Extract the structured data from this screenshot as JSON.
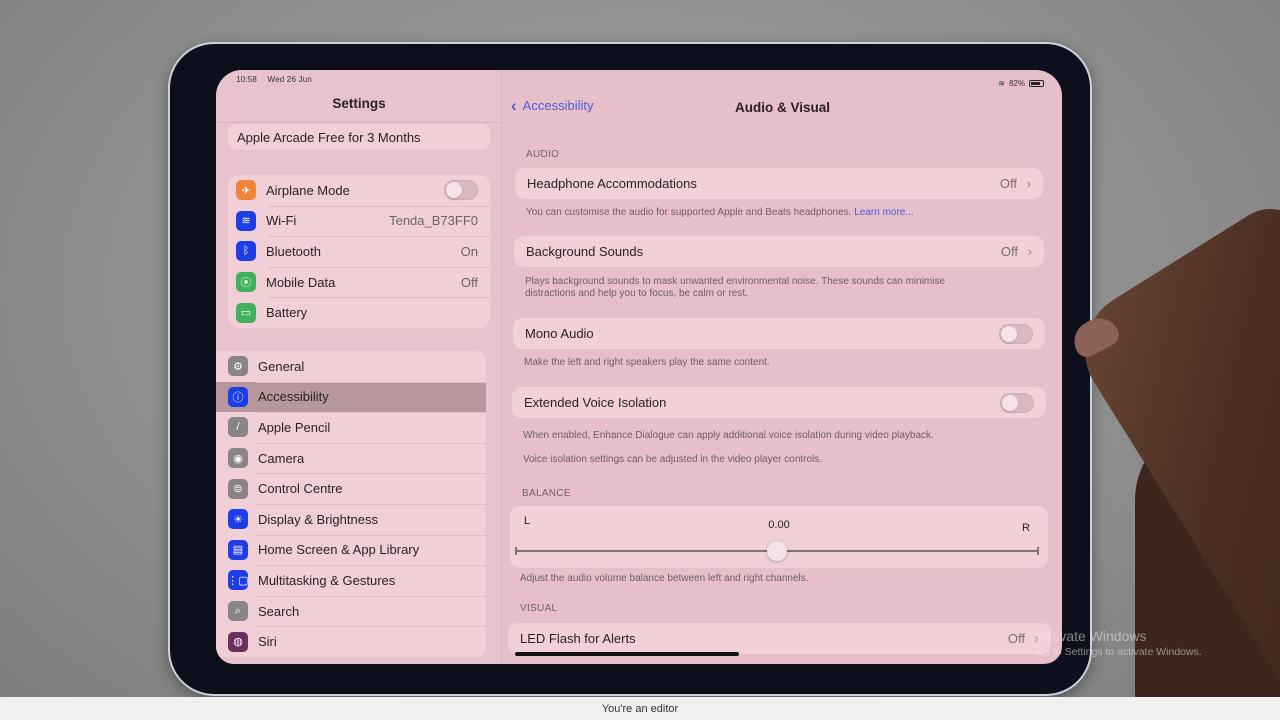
{
  "status_bar": {
    "time": "10:58",
    "date": "Wed 26 Jun",
    "battery_percent": "82%",
    "wifi_icon": "wifi-icon",
    "battery_icon": "battery-icon"
  },
  "sidebar": {
    "title": "Settings",
    "promo": "Apple Arcade Free for 3 Months",
    "connectivity": [
      {
        "label": "Airplane Mode",
        "icon": "airplane-icon",
        "color": "#f0853a",
        "glyph": "✈",
        "control": "toggle",
        "state": "off"
      },
      {
        "label": "Wi-Fi",
        "icon": "wifi-icon",
        "color": "#1f3de6",
        "glyph": "≋",
        "value": "Tenda_B73FF0"
      },
      {
        "label": "Bluetooth",
        "icon": "bluetooth-icon",
        "color": "#1f3de6",
        "glyph": "ᛒ",
        "value": "On"
      },
      {
        "label": "Mobile Data",
        "icon": "antenna-icon",
        "color": "#43b05c",
        "glyph": "⦿",
        "value": "Off"
      },
      {
        "label": "Battery",
        "icon": "battery-icon",
        "color": "#43b05c",
        "glyph": "▭"
      }
    ],
    "general": [
      {
        "label": "General",
        "icon": "gear-icon",
        "color": "#8a8488",
        "glyph": "⚙"
      },
      {
        "label": "Accessibility",
        "icon": "accessibility-icon",
        "color": "#1f3de6",
        "glyph": "ⓘ",
        "selected": true
      },
      {
        "label": "Apple Pencil",
        "icon": "pencil-icon",
        "color": "#8a8488",
        "glyph": "/"
      },
      {
        "label": "Camera",
        "icon": "camera-icon",
        "color": "#8a8488",
        "glyph": "◉"
      },
      {
        "label": "Control Centre",
        "icon": "switches-icon",
        "color": "#8a8488",
        "glyph": "⊜"
      },
      {
        "label": "Display & Brightness",
        "icon": "sun-icon",
        "color": "#1f3de6",
        "glyph": "☀"
      },
      {
        "label": "Home Screen & App Library",
        "icon": "home-screen-icon",
        "color": "#1f3de6",
        "glyph": "▤"
      },
      {
        "label": "Multitasking & Gestures",
        "icon": "multitasking-icon",
        "color": "#1f3de6",
        "glyph": "⋮▢"
      },
      {
        "label": "Search",
        "icon": "search-icon",
        "color": "#8a8488",
        "glyph": "⌕"
      },
      {
        "label": "Siri",
        "icon": "siri-icon",
        "color": "#6a2f5e",
        "glyph": "◍"
      }
    ]
  },
  "detail": {
    "back_label": "Accessibility",
    "title": "Audio & Visual",
    "sections": {
      "audio_header": "AUDIO",
      "balance_header": "BALANCE",
      "visual_header": "VISUAL"
    },
    "headphone": {
      "label": "Headphone Accommodations",
      "value": "Off",
      "footnote": "You can customise the audio for supported Apple and Beats headphones.",
      "link": "Learn more..."
    },
    "background_sounds": {
      "label": "Background Sounds",
      "value": "Off",
      "footnote": "Plays background sounds to mask unwanted environmental noise. These sounds can minimise distractions and help you to focus, be calm or rest."
    },
    "mono_audio": {
      "label": "Mono Audio",
      "state": "off",
      "footnote": "Make the left and right speakers play the same content."
    },
    "voice_isolation": {
      "label": "Extended Voice Isolation",
      "state": "off",
      "footnote1": "When enabled, Enhance Dialogue can apply additional voice isolation during video playback.",
      "footnote2": "Voice isolation settings can be adjusted in the video player controls."
    },
    "balance": {
      "left": "L",
      "right": "R",
      "value_label": "0.00",
      "value": 0.0,
      "min": -1,
      "max": 1,
      "footnote": "Adjust the audio volume balance between left and right channels."
    },
    "led_flash": {
      "label": "LED Flash for Alerts",
      "value": "Off"
    }
  },
  "watermark": {
    "title": "Activate Windows",
    "subtitle": "Go to Settings to activate Windows."
  },
  "bottom_bar": {
    "text": "You're an editor"
  }
}
